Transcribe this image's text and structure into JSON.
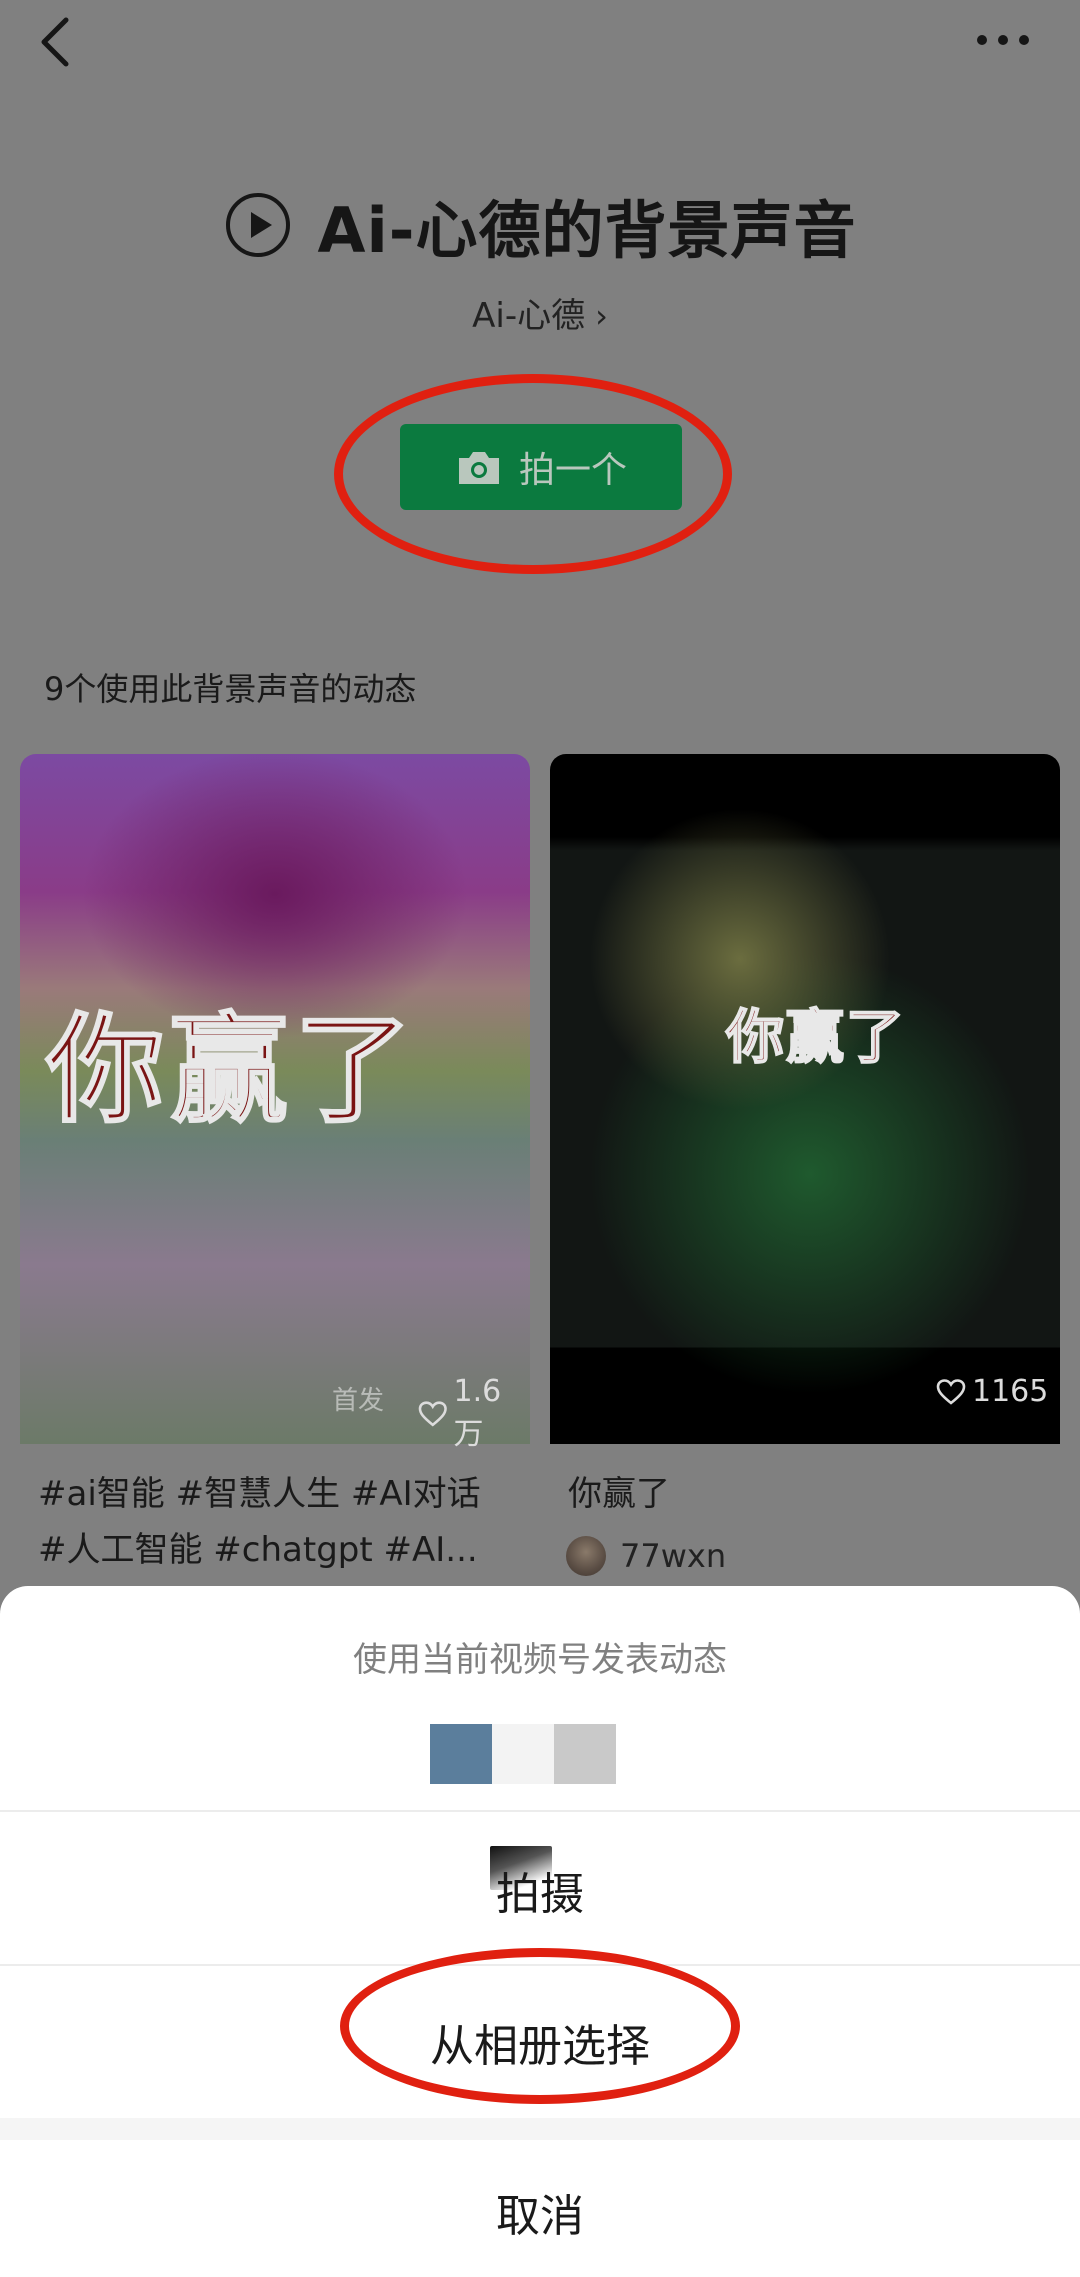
{
  "header": {
    "back_icon": "chevron-left-icon",
    "more_icon": "more-dots-icon"
  },
  "audio": {
    "title": "Ai-心德的背景声音",
    "author": "Ai-心德",
    "play_icon": "play-circle-icon"
  },
  "shoot_button": {
    "label": "拍一个",
    "icon": "camera-icon",
    "color": "#0b7a3f"
  },
  "annotation_color": "#e02010",
  "feed": {
    "count_label": "9个使用此背景声音的动态",
    "cards": [
      {
        "thumb_text": "你赢了",
        "badge": "首发",
        "likes": "1.6万",
        "caption_lines": [
          "#ai智能 #智慧人生 #AI对话",
          "#人工智能 #chatgpt #AI..."
        ]
      },
      {
        "thumb_text": "你赢了",
        "likes": "1165",
        "caption": "你赢了",
        "author": "77wxn"
      }
    ]
  },
  "sheet": {
    "title": "使用当前视频号发表动态",
    "account_swatch_colors": [
      "#5b7e9c",
      "#f3f3f3",
      "#c9c9c9"
    ],
    "options": {
      "shoot": "拍摄",
      "from_album": "从相册选择",
      "cancel": "取消"
    }
  }
}
